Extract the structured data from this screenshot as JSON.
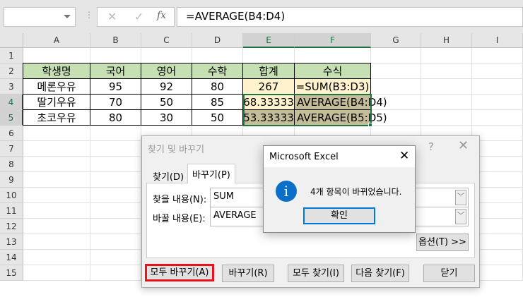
{
  "formula_bar": {
    "name_box": "",
    "formula": "=AVERAGE(B4:D4)",
    "cancel_icon": "✕",
    "enter_icon": "✓",
    "fx_icon": "fx"
  },
  "columns": [
    "A",
    "B",
    "C",
    "D",
    "E",
    "F",
    "G",
    "H",
    "I"
  ],
  "rows": [
    "1",
    "2",
    "3",
    "4",
    "5",
    "6",
    "7",
    "8",
    "9",
    "10",
    "11",
    "12",
    "13",
    "14",
    "15"
  ],
  "table": {
    "header": [
      "학생명",
      "국어",
      "영어",
      "수학",
      "합계",
      "수식"
    ],
    "body": [
      [
        "메론우유",
        "95",
        "92",
        "80",
        "267",
        "=SUM(B3:D3)"
      ],
      [
        "딸기우유",
        "70",
        "50",
        "85",
        "68.33333",
        "AVERAGE(B4:D4)"
      ],
      [
        "초코우유",
        "80",
        "30",
        "50",
        "53.33333",
        "AVERAGE(B5:D5)"
      ]
    ]
  },
  "colors": {
    "header_fill": "#c6e0b4",
    "light_fill": "#fff2cc",
    "dark_fill": "#c4bd97",
    "accent": "#217346"
  },
  "find_dialog": {
    "title": "찾기 및 바꾸기",
    "help": "?",
    "close": "✕",
    "tabs": [
      "찾기(D)",
      "바꾸기(P)"
    ],
    "find_label": "찾을 내용(N):",
    "find_value": "SUM",
    "replace_label": "바꿀 내용(E):",
    "replace_value": "AVERAGE",
    "options_button": "옵션(T) >>",
    "buttons": [
      "모두 바꾸기(A)",
      "바꾸기(R)",
      "모두 찾기(I)",
      "다음 찾기(F)",
      "닫기"
    ]
  },
  "message_box": {
    "title": "Microsoft Excel",
    "close": "✕",
    "icon": "i",
    "message": "4개 항목이 바뀌었습니다.",
    "ok": "확인"
  }
}
